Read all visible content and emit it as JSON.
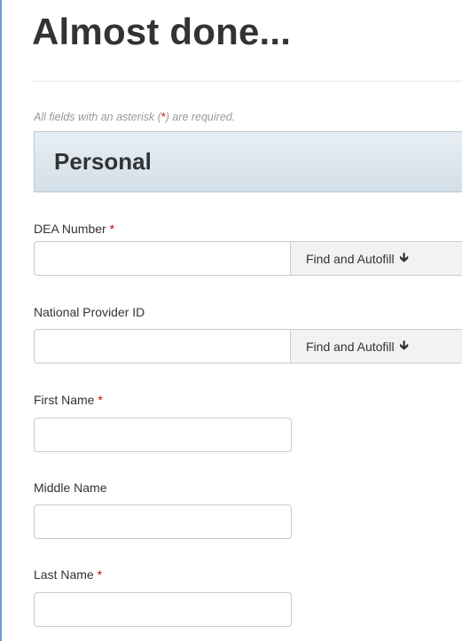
{
  "page": {
    "title": "Almost done...",
    "required_note_prefix": "All fields with an asterisk (",
    "required_note_star": "*",
    "required_note_suffix": ") are required."
  },
  "section": {
    "title": "Personal"
  },
  "fields": {
    "dea_number": {
      "label": "DEA Number",
      "required_mark": "*",
      "value": "",
      "button_label": "Find and Autofill",
      "button_icon": "arrow-down-icon"
    },
    "npi": {
      "label": "National Provider ID",
      "value": "",
      "button_label": "Find and Autofill",
      "button_icon": "arrow-down-icon"
    },
    "first_name": {
      "label": "First Name",
      "required_mark": "*",
      "value": ""
    },
    "middle_name": {
      "label": "Middle Name",
      "value": ""
    },
    "last_name": {
      "label": "Last Name",
      "required_mark": "*",
      "value": ""
    }
  },
  "colors": {
    "required": "#cc0000",
    "section_bg": "#dbe5ee",
    "frame_border": "#6e9bd6"
  }
}
